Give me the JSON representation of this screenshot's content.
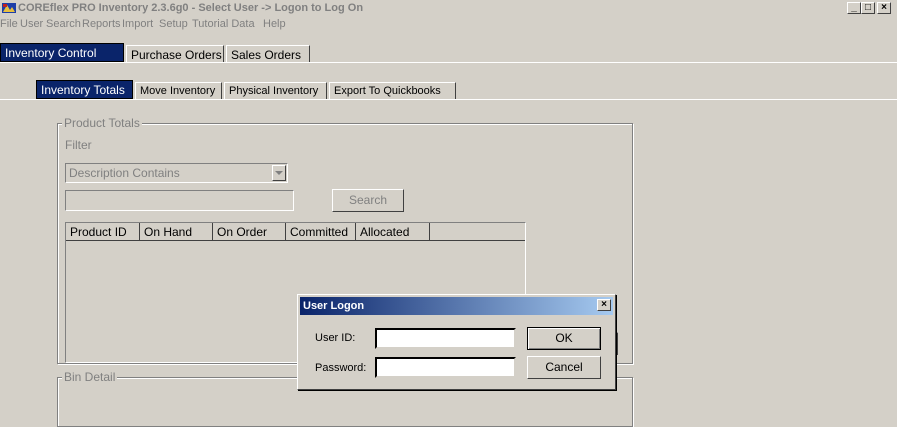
{
  "window": {
    "title": "COREflex PRO Inventory 2.3.6g0 - Select User -> Logon to Log On",
    "controls": {
      "minimize": "_",
      "maximize": "□",
      "close": "×"
    }
  },
  "menu": [
    "File",
    "User",
    "Search",
    "Reports",
    "Import",
    "Setup",
    "Tutorial Data",
    "Help"
  ],
  "main_tabs": [
    "Inventory Control",
    "Purchase Orders",
    "Sales Orders"
  ],
  "sub_tabs": [
    "Inventory Totals",
    "Move Inventory",
    "Physical Inventory",
    "Export To Quickbooks"
  ],
  "product_totals": {
    "group_label": "Product Totals",
    "filter_label": "Filter",
    "filter_select_value": "Description Contains",
    "search_input_value": "",
    "search_button": "Search",
    "columns": [
      "Product ID",
      "On Hand",
      "On Order",
      "Committed",
      "Allocated"
    ]
  },
  "bin_detail": {
    "group_label": "Bin Detail"
  },
  "dialog": {
    "title": "User Logon",
    "close": "×",
    "user_id_label": "User ID:",
    "password_label": "Password:",
    "user_id_value": "",
    "password_value": "",
    "ok_button": "OK",
    "cancel_button": "Cancel"
  },
  "colors": {
    "active_tab": "#0a246a",
    "face": "#d4d0c8"
  }
}
